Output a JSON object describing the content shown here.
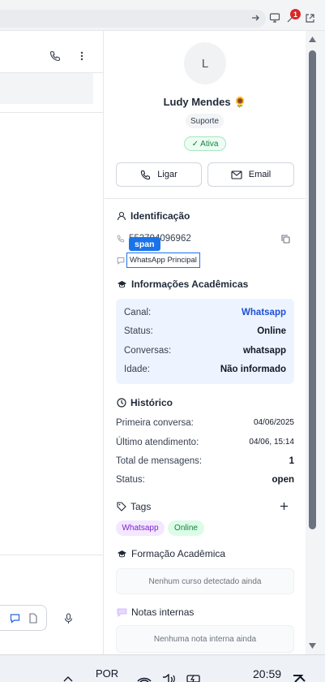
{
  "browser": {
    "badge_count": "1"
  },
  "contact": {
    "avatar_initial": "L",
    "name": "Ludy Mendes 🌻",
    "role": "Suporte",
    "status": "✓ Ativa",
    "call_label": "Ligar",
    "email_label": "Email"
  },
  "identificacao": {
    "title": "Identificação",
    "phone": "553794096962",
    "inspector_tag": "span",
    "channel_name": "WhatsApp Principal"
  },
  "academicas": {
    "title": "Informações Acadêmicas",
    "rows": [
      {
        "label": "Canal:",
        "value": "Whatsapp"
      },
      {
        "label": "Status:",
        "value": "Online"
      },
      {
        "label": "Conversas:",
        "value": "whatsapp"
      },
      {
        "label": "Idade:",
        "value": "Não informado"
      }
    ]
  },
  "historico": {
    "title": "Histórico",
    "rows": [
      {
        "label": "Primeira conversa:",
        "value": "04/06/2025"
      },
      {
        "label": "Último atendimento:",
        "value": "04/06, 15:14"
      },
      {
        "label": "Total de mensagens:",
        "value": "1"
      },
      {
        "label": "Status:",
        "value": "open"
      }
    ]
  },
  "tags": {
    "title": "Tags",
    "items": [
      "Whatsapp",
      "Online"
    ]
  },
  "formacao": {
    "title": "Formação Acadêmica",
    "empty": "Nenhum curso detectado ainda"
  },
  "notas": {
    "title": "Notas internas",
    "empty": "Nenhuma nota interna ainda"
  },
  "taskbar": {
    "language": "POR",
    "time": "20:59"
  },
  "colors": {
    "accent_blue": "#1d4ed8",
    "status_green": "#15803d",
    "tag_purple": "#7e22ce",
    "inspector_blue": "#1a73e8"
  }
}
